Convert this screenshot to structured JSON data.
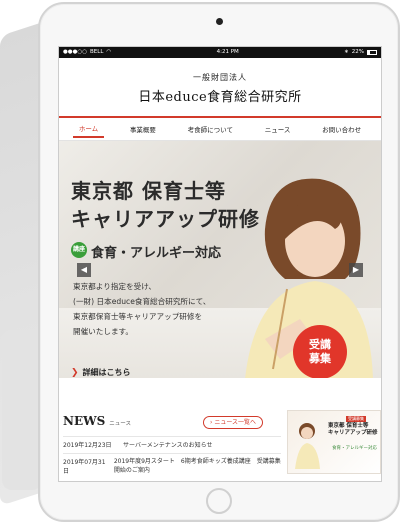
{
  "statusbar": {
    "carrier": "BELL",
    "time": "4:21 PM",
    "battery": "22%"
  },
  "header": {
    "org_small": "一般財団法人",
    "org_big": "日本educe食育総合研究所"
  },
  "nav": {
    "items": [
      "ホーム",
      "事業概要",
      "考食師について",
      "ニュース",
      "お問い合わせ"
    ],
    "active": 0
  },
  "hero": {
    "title_line1": "東京都 保育士等",
    "title_line2": "キャリアアップ研修",
    "tag": "講座",
    "subtitle": "食育・アレルギー対応",
    "text_line1": "東京都より指定を受け、",
    "text_line2": "(一財) 日本educe食育総合研究所にて、",
    "text_line3": "東京都保育士等キャリアアップ研修を",
    "text_line4": "開催いたします。",
    "detail_label": "詳細はこちら",
    "badge_line1": "受講",
    "badge_line2": "募集"
  },
  "news": {
    "heading": "NEWS",
    "heading_sub": "ニュース",
    "all_button": "ニュース一覧へ",
    "rows": [
      {
        "date": "2019年12月23日",
        "text": "サーバーメンテナンスのお知らせ"
      },
      {
        "date": "2019年07月31日",
        "text": "2019年度9月スタート　6期考食師キッズ養成講座　受講募集開始のご案内"
      }
    ]
  },
  "side_banner": {
    "tag": "受講募集",
    "line1": "東京都 保育士等",
    "line2": "キャリアアップ研修",
    "line3": "食育・アレルギー対応"
  },
  "colors": {
    "accent": "#d23a2b",
    "green": "#3a9e3a"
  }
}
